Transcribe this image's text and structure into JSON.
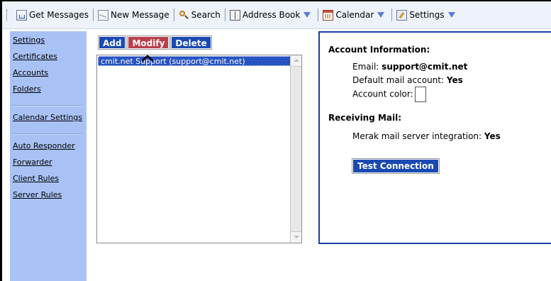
{
  "toolbar": {
    "get_messages": "Get Messages",
    "new_message": "New Message",
    "search": "Search",
    "address_book": "Address Book",
    "calendar": "Calendar",
    "settings": "Settings"
  },
  "sidebar": {
    "items": [
      {
        "label": "Settings"
      },
      {
        "label": "Certificates"
      },
      {
        "label": "Accounts"
      },
      {
        "label": "Folders"
      },
      {
        "label": "Calendar Settings"
      },
      {
        "label": "Auto Responder"
      },
      {
        "label": "Forwarder"
      },
      {
        "label": "Client Rules"
      },
      {
        "label": "Server Rules"
      }
    ]
  },
  "actions": {
    "add": "Add",
    "modify": "Modify",
    "delete": "Delete"
  },
  "accounts": {
    "selected_item": "cmit.net Support (support@cmit.net)"
  },
  "info": {
    "account_header": "Account Information:",
    "email_label": "Email:",
    "email_value": "support@cmit.net",
    "default_label": "Default mail account:",
    "default_value": "Yes",
    "color_label": "Account color:",
    "receiving_header": "Receiving Mail:",
    "merak_label": "Merak mail server integration:",
    "merak_value": "Yes",
    "test_button": "Test Connection"
  },
  "colors": {
    "sidebar_bg": "#a9c2f5",
    "button_blue": "#1a49b3",
    "button_red": "#b9404a",
    "selection": "#2853c2"
  }
}
